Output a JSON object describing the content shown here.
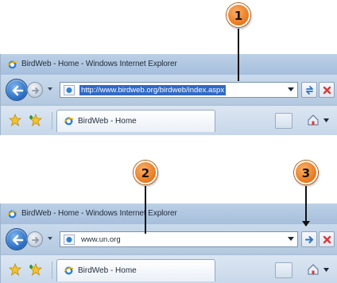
{
  "panels": [
    {
      "window_title": "BirdWeb - Home - Windows Internet Explorer",
      "address": "http://www.birdweb.org/birdweb/index.aspx",
      "address_selected": true,
      "tab_label": "BirdWeb - Home"
    },
    {
      "window_title": "BirdWeb - Home - Windows Internet Explorer",
      "address": "www.un.org",
      "address_selected": false,
      "tab_label": "BirdWeb - Home"
    }
  ],
  "callouts": [
    "1",
    "2",
    "3"
  ],
  "icons": {
    "back": "back-arrow-icon",
    "forward": "forward-arrow-icon",
    "refresh": "refresh-icon",
    "stop": "stop-x-icon",
    "favorites": "favorites-star-icon",
    "add_favorites": "add-favorites-icon",
    "home": "home-icon"
  },
  "colors": {
    "selection": "#3169c6",
    "callout": "#e9781c",
    "stop": "#d9383a",
    "chrome": "#bcd0e6"
  }
}
